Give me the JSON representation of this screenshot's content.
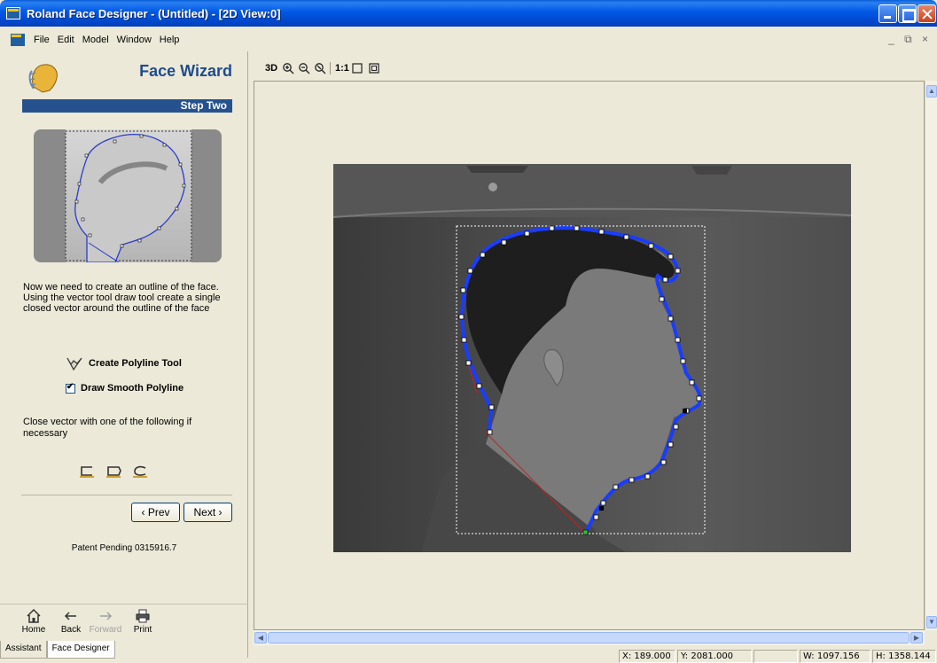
{
  "window": {
    "title": "Roland Face Designer - (Untitled) - [2D View:0]"
  },
  "menu": {
    "items": [
      "File",
      "Edit",
      "Model",
      "Window",
      "Help"
    ],
    "mdi_controls": "_ ⧉ ×"
  },
  "assistant": {
    "title": "Face Wizard",
    "step": "Step Two",
    "instructions": "Now we need to create an outline of the face. Using the vector tool draw tool create a single closed vector around the outline of the face",
    "tool_label": "Create Polyline Tool",
    "smooth_label": "Draw Smooth Polyline",
    "smooth_checked": true,
    "close_text": "Close vector with one of the following if necessary",
    "prev_label": "‹ Prev",
    "next_label": "Next ›",
    "patent": "Patent Pending 0315916.7",
    "bottom_buttons": [
      "Home",
      "Back",
      "Forward",
      "Print"
    ],
    "tabs": [
      "Assistant",
      "Face Designer"
    ],
    "active_tab": "Face Designer"
  },
  "view_toolbar": {
    "items": [
      "3D",
      "1:1"
    ]
  },
  "status": {
    "x": "X: 189.000",
    "y": "Y: 2081.000",
    "w": "W: 1097.156",
    "h": "H: 1358.144"
  },
  "colors": {
    "titlebar": "#0058e6",
    "step_bar": "#25528f",
    "wizard_title": "#1f4b8e",
    "vector_outline": "#1a3cff",
    "closing_line": "#cc2020"
  }
}
